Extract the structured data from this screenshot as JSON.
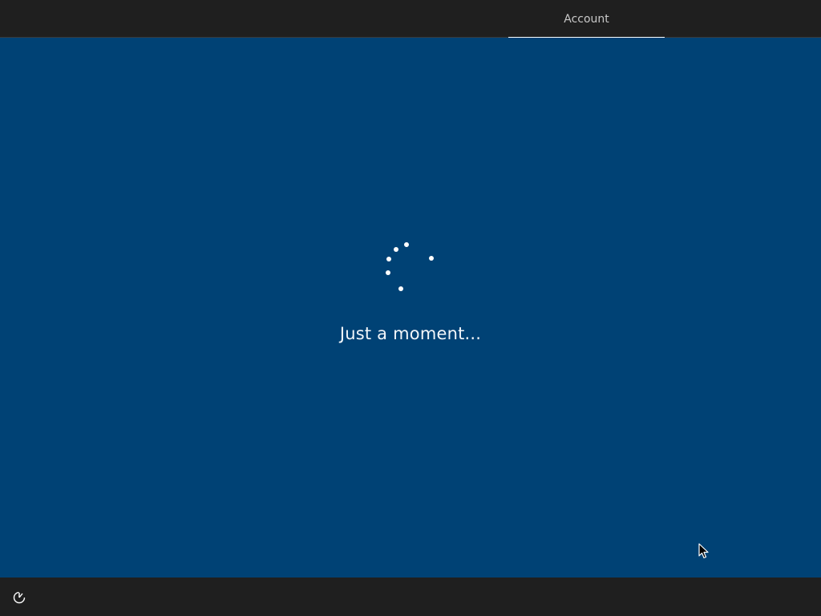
{
  "header": {
    "tabs": [
      {
        "label": "Account",
        "active": true
      }
    ]
  },
  "main": {
    "status_text": "Just a moment..."
  },
  "footer": {
    "ease_of_access_icon": "ease-of-access-icon"
  },
  "colors": {
    "background": "#004275",
    "bar": "#1f1f1f",
    "text": "#f2f6fa",
    "tab_text": "#c8c8c8"
  }
}
